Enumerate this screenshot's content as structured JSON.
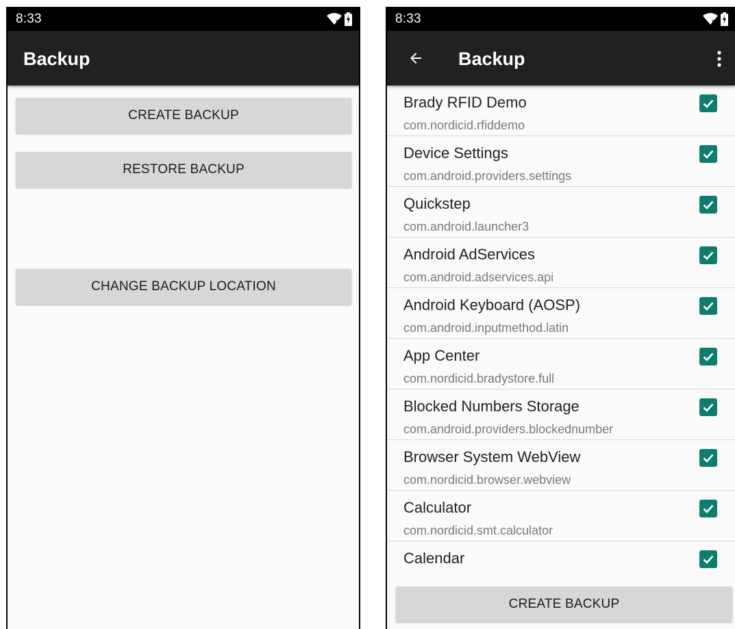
{
  "left": {
    "status": {
      "time": "8:33"
    },
    "appbar": {
      "title": "Backup"
    },
    "buttons": {
      "create": "CREATE BACKUP",
      "restore": "RESTORE BACKUP",
      "change_location": "CHANGE BACKUP LOCATION"
    }
  },
  "right": {
    "status": {
      "time": "8:33"
    },
    "appbar": {
      "title": "Backup"
    },
    "apps": [
      {
        "name": "Brady RFID Demo",
        "package": "com.nordicid.rfiddemo",
        "checked": true
      },
      {
        "name": "Device Settings",
        "package": "com.android.providers.settings",
        "checked": true
      },
      {
        "name": "Quickstep",
        "package": "com.android.launcher3",
        "checked": true
      },
      {
        "name": "Android AdServices",
        "package": "com.android.adservices.api",
        "checked": true
      },
      {
        "name": "Android Keyboard (AOSP)",
        "package": "com.android.inputmethod.latin",
        "checked": true
      },
      {
        "name": "App Center",
        "package": "com.nordicid.bradystore.full",
        "checked": true
      },
      {
        "name": "Blocked Numbers Storage",
        "package": "com.android.providers.blockednumber",
        "checked": true
      },
      {
        "name": "Browser System WebView",
        "package": "com.nordicid.browser.webview",
        "checked": true
      },
      {
        "name": "Calculator",
        "package": "com.nordicid.smt.calculator",
        "checked": true
      },
      {
        "name": "Calendar",
        "package": "",
        "checked": true
      }
    ],
    "create_button": "CREATE BACKUP"
  },
  "colors": {
    "accent": "#0f7d6e",
    "appbar": "#212121",
    "button": "#d6d7d7"
  },
  "icons": [
    "wifi-icon",
    "battery-charging-icon",
    "back-arrow-icon",
    "more-vert-icon",
    "checkbox-checked-icon"
  ]
}
